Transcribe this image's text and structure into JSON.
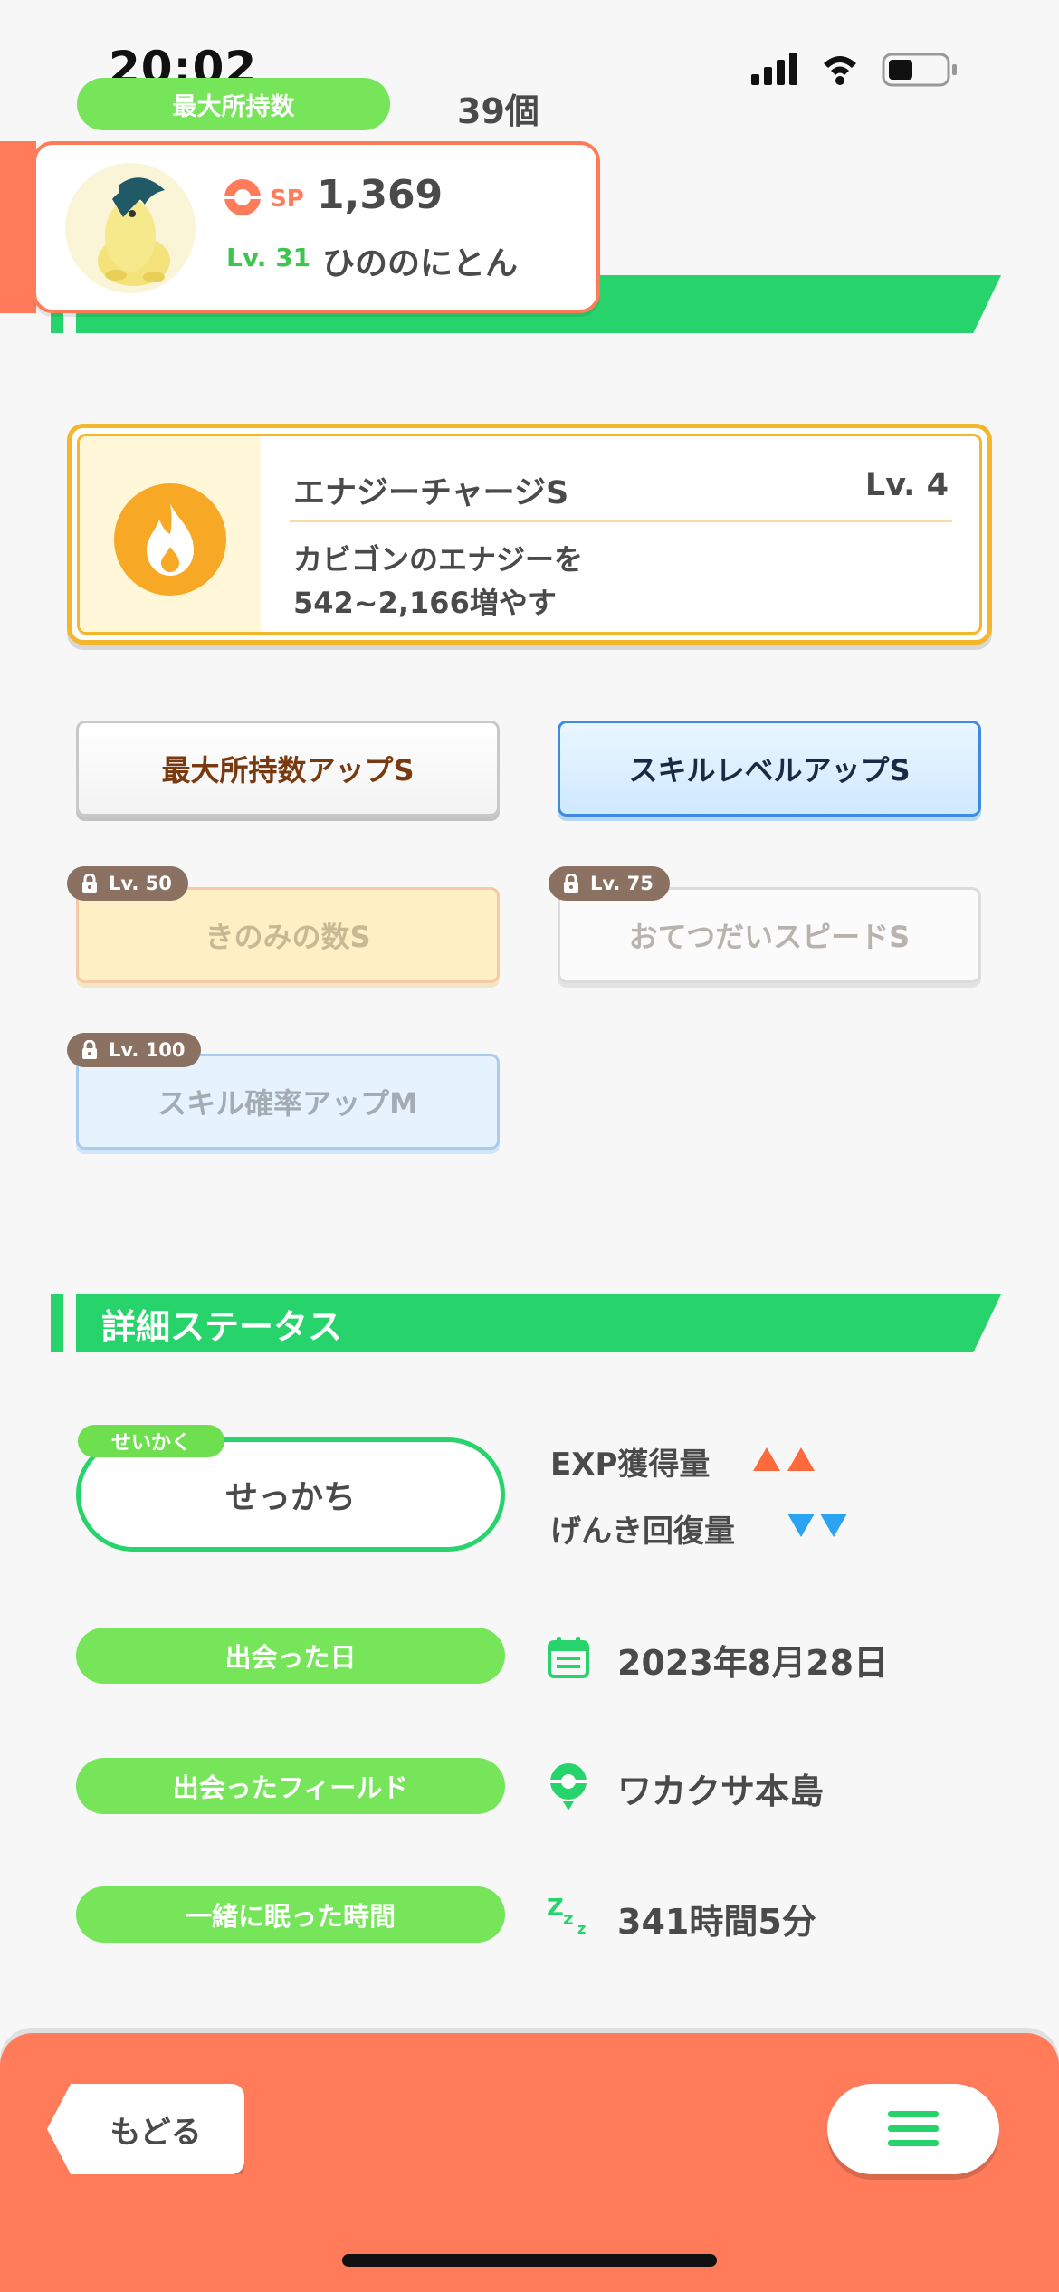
{
  "status_bar": {
    "time": "20:02"
  },
  "header": {
    "max_carry_label": "最大所持数",
    "max_carry_value": "39個"
  },
  "mon": {
    "sp_label": "SP",
    "sp_value": "1,369",
    "level": "Lv. 31",
    "name": "ひののにとん"
  },
  "main_skill": {
    "name": "エナジーチャージS",
    "level": "Lv. 4",
    "description": "カビゴンのエナジーを\n542~2,166増やす"
  },
  "sub_skills": [
    {
      "label": "最大所持数アップS",
      "unlock": "",
      "locked": false
    },
    {
      "label": "スキルレベルアップS",
      "unlock": "",
      "locked": false
    },
    {
      "label": "きのみの数S",
      "unlock": "Lv. 50",
      "locked": true
    },
    {
      "label": "おてつだいスピードS",
      "unlock": "Lv. 75",
      "locked": true
    },
    {
      "label": "スキル確率アップM",
      "unlock": "Lv. 100",
      "locked": true
    }
  ],
  "detail": {
    "section_title": "詳細ステータス",
    "nature_tag": "せいかく",
    "nature": "せっかち",
    "up_stat": "EXP獲得量",
    "down_stat": "げんき回復量",
    "met_date_label": "出会った日",
    "met_date": "2023年8月28日",
    "met_field_label": "出会ったフィールド",
    "met_field": "ワカクサ本島",
    "slept_label": "一緒に眠った時間",
    "slept": "341時間5分"
  },
  "footer": {
    "back_label": "もどる"
  },
  "colors": {
    "accent_green": "#26d46b",
    "pill_green": "#76e55a",
    "coral": "#ff7b5a",
    "skill_gold": "#f5b62b"
  }
}
